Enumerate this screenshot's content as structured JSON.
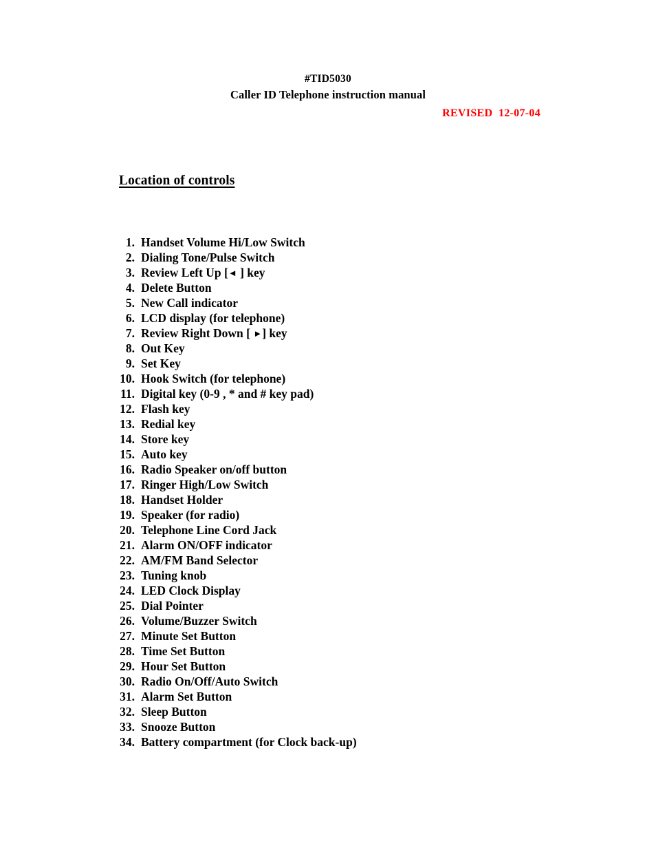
{
  "document": {
    "code": "#TID5030",
    "subtitle": "Caller ID Telephone instruction manual",
    "revised": "REVISED  12-07-04",
    "revised_color": "#FF0000",
    "section_heading": "Location of controls",
    "background_color": "#FFFFFF",
    "text_color": "#000000"
  },
  "controls": [
    {
      "number": "1.",
      "label": "Handset Volume Hi/Low Switch"
    },
    {
      "number": "2.",
      "label": "Dialing Tone/Pulse Switch"
    },
    {
      "number": "3.",
      "label": "Review Left Up [◄ ] key"
    },
    {
      "number": "4.",
      "label": "Delete Button"
    },
    {
      "number": "5.",
      "label": "New Call indicator"
    },
    {
      "number": "6.",
      "label": "LCD display (for telephone)"
    },
    {
      "number": "7.",
      "label": "Review Right Down [ ►] key"
    },
    {
      "number": "8.",
      "label": "Out Key"
    },
    {
      "number": "9.",
      "label": "Set Key"
    },
    {
      "number": "10.",
      "label": "Hook Switch (for telephone)"
    },
    {
      "number": "11.",
      "label": "Digital key (0-9 , * and # key pad)"
    },
    {
      "number": "12.",
      "label": "Flash key"
    },
    {
      "number": "13.",
      "label": "Redial key"
    },
    {
      "number": "14.",
      "label": "Store key"
    },
    {
      "number": "15.",
      "label": "Auto key"
    },
    {
      "number": "16.",
      "label": "Radio Speaker on/off button"
    },
    {
      "number": "17.",
      "label": "Ringer High/Low Switch"
    },
    {
      "number": "18.",
      "label": "Handset Holder"
    },
    {
      "number": "19.",
      "label": "Speaker (for radio)"
    },
    {
      "number": "20.",
      "label": "Telephone Line Cord Jack"
    },
    {
      "number": "21.",
      "label": "Alarm ON/OFF indicator"
    },
    {
      "number": "22.",
      "label": "AM/FM Band Selector"
    },
    {
      "number": "23.",
      "label": "Tuning knob"
    },
    {
      "number": "24.",
      "label": "LED Clock Display"
    },
    {
      "number": "25.",
      "label": "Dial Pointer"
    },
    {
      "number": "26.",
      "label": "Volume/Buzzer Switch"
    },
    {
      "number": "27.",
      "label": "Minute Set Button"
    },
    {
      "number": "28.",
      "label": "Time Set Button"
    },
    {
      "number": "29.",
      "label": "Hour Set Button"
    },
    {
      "number": "30.",
      "label": "Radio On/Off/Auto Switch"
    },
    {
      "number": "31.",
      "label": "Alarm Set Button"
    },
    {
      "number": "32.",
      "label": "Sleep Button"
    },
    {
      "number": "33.",
      "label": "Snooze Button"
    },
    {
      "number": "34.",
      "label": "Battery compartment (for Clock back-up)"
    }
  ]
}
